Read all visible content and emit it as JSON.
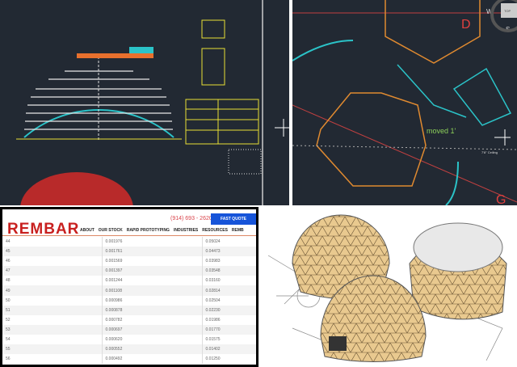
{
  "cad_plan": {
    "room_labels": [
      "D",
      "G"
    ],
    "annotation": "moved 1'",
    "note": "7'8\" Ceiling",
    "viewcube": {
      "face": "TOP",
      "north": "W",
      "south": "S"
    }
  },
  "website": {
    "logo": "REMBAR",
    "phone": "(914) 693 - 2620",
    "quote_button": "FAST QUOTE",
    "nav": [
      "ABOUT",
      "OUR STOCK",
      "RAPID PROTOTYPING",
      "INDUSTRIES",
      "RESOURCES",
      "REMB"
    ],
    "rows": [
      [
        "44",
        "0.001976",
        "0.05024"
      ],
      [
        "45",
        "0.001761",
        "0.04473"
      ],
      [
        "46",
        "0.001569",
        "0.03983"
      ],
      [
        "47",
        "0.001397",
        "0.03548"
      ],
      [
        "48",
        "0.001244",
        "0.03160"
      ],
      [
        "49",
        "0.001108",
        "0.02814"
      ],
      [
        "50",
        "0.000986",
        "0.02504"
      ],
      [
        "51",
        "0.000878",
        "0.02230"
      ],
      [
        "52",
        "0.000782",
        "0.01986"
      ],
      [
        "53",
        "0.000697",
        "0.01770"
      ],
      [
        "54",
        "0.000620",
        "0.01575"
      ],
      [
        "55",
        "0.000552",
        "0.01402"
      ],
      [
        "56",
        "0.000492",
        "0.01250"
      ]
    ]
  },
  "colors": {
    "cad_bg": "#222933",
    "brand": "#c8201f",
    "quote": "#1654d9",
    "dome": "#e9c98f"
  }
}
